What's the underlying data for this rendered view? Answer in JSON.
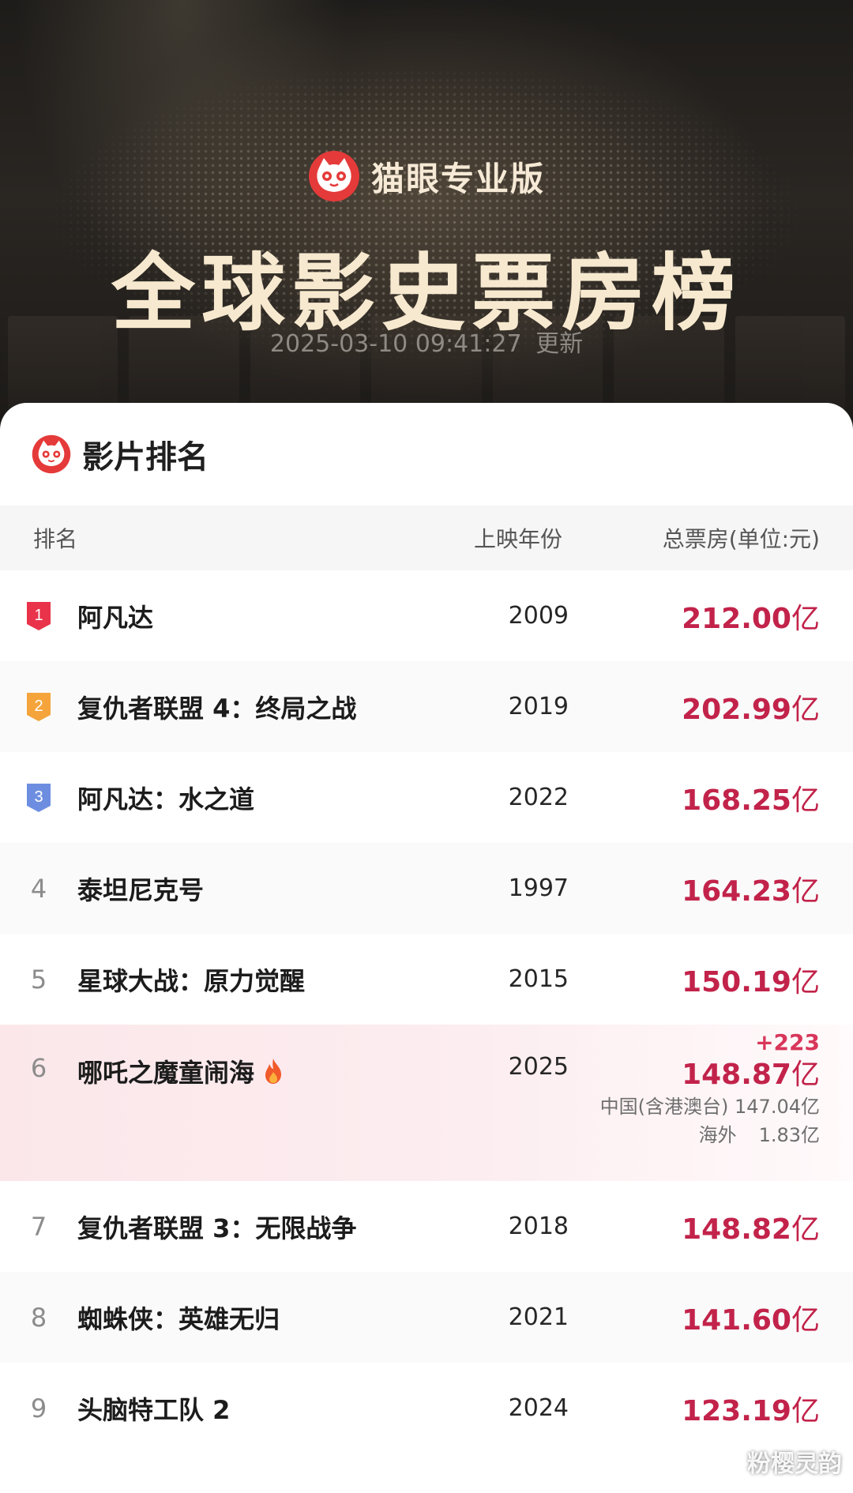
{
  "hero": {
    "brand": "猫眼专业版",
    "title": "全球影史票房榜",
    "updated_time": "2025-03-10 09:41:27",
    "updated_suffix": "更新"
  },
  "card": {
    "title": "影片排名"
  },
  "columns": {
    "rank": "排名",
    "year": "上映年份",
    "total": "总票房(单位:元)"
  },
  "unit": "亿",
  "rows": [
    {
      "rank": "1",
      "name": "阿凡达",
      "year": "2009",
      "total": "212.00"
    },
    {
      "rank": "2",
      "name": "复仇者联盟 4：终局之战",
      "year": "2019",
      "total": "202.99"
    },
    {
      "rank": "3",
      "name": "阿凡达：水之道",
      "year": "2022",
      "total": "168.25"
    },
    {
      "rank": "4",
      "name": "泰坦尼克号",
      "year": "1997",
      "total": "164.23"
    },
    {
      "rank": "5",
      "name": "星球大战：原力觉醒",
      "year": "2015",
      "total": "150.19"
    },
    {
      "rank": "6",
      "name": "哪吒之魔童闹海",
      "year": "2025",
      "total": "148.87",
      "delta": "+223",
      "china_label": "中国(含港澳台)",
      "china_value": "147.04亿",
      "overseas_label": "海外",
      "overseas_value": "1.83亿"
    },
    {
      "rank": "7",
      "name": "复仇者联盟 3：无限战争",
      "year": "2018",
      "total": "148.82"
    },
    {
      "rank": "8",
      "name": "蜘蛛侠：英雄无归",
      "year": "2021",
      "total": "141.60"
    },
    {
      "rank": "9",
      "name": "头脑特工队 2",
      "year": "2024",
      "total": "123.19"
    }
  ],
  "watermark": "粉樱灵韵",
  "colors": {
    "accent": "#c2234a",
    "gold": "#f7e9cf",
    "rank1": "#e8334a",
    "rank2": "#f4a43a",
    "rank3": "#6d8ee0"
  },
  "icons": {
    "brand_logo": "maoyan-cat-icon",
    "hot": "fire-icon"
  }
}
